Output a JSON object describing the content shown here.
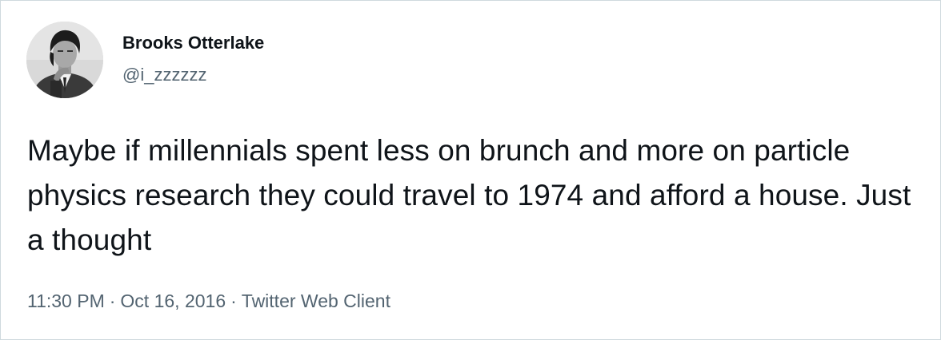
{
  "author": {
    "display_name": "Brooks Otterlake",
    "handle": "@i_zzzzzz",
    "avatar": "grayscale portrait photo"
  },
  "tweet": {
    "text": "Maybe if millennials spent less on brunch and more on particle physics research they could travel to 1974 and afford a house. Just a thought"
  },
  "meta": {
    "time": "11:30 PM",
    "separator": "·",
    "date": "Oct 16, 2016",
    "source": "Twitter Web Client"
  },
  "colors": {
    "text": "#0f1419",
    "secondary_text": "#536471",
    "border": "#cfd9de"
  }
}
